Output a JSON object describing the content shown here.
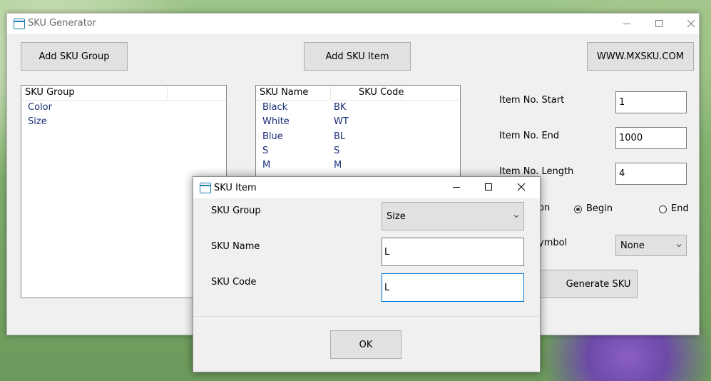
{
  "main_window": {
    "title": "SKU Generator",
    "add_group_button": "Add SKU Group",
    "add_item_button": "Add SKU Item",
    "website_button": "WWW.MXSKU.COM",
    "group_list": {
      "header": "SKU Group",
      "items": [
        "Color",
        "Size"
      ]
    },
    "item_list": {
      "headers": [
        "SKU Name",
        "SKU Code"
      ],
      "rows": [
        {
          "name": "Black",
          "code": "BK"
        },
        {
          "name": "White",
          "code": "WT"
        },
        {
          "name": "Blue",
          "code": "BL"
        },
        {
          "name": "S",
          "code": "S"
        },
        {
          "name": "M",
          "code": "M"
        }
      ]
    },
    "settings": {
      "item_start_label": "Item No. Start",
      "item_start_value": "1",
      "item_end_label": "Item No. End",
      "item_end_value": "1000",
      "item_length_label": "Item No. Length",
      "item_length_value": "4",
      "position_label_partial": "on",
      "position_options": [
        {
          "label": "Begin",
          "selected": true
        },
        {
          "label": "End",
          "selected": false
        }
      ],
      "symbol_label_partial": "ymbol",
      "symbol_value": "None",
      "generate_button": "Generate SKU"
    }
  },
  "dialog": {
    "title": "SKU Item",
    "group_label": "SKU Group",
    "group_value": "Size",
    "name_label": "SKU Name",
    "name_value": "L",
    "code_label": "SKU Code",
    "code_value": "L",
    "ok_button": "OK"
  },
  "icons": [
    "app-window-icon",
    "minimize-icon",
    "maximize-icon",
    "close-icon",
    "chevron-down-icon"
  ],
  "colors": {
    "accent": "#0078d7",
    "list_text": "#1a2f7a",
    "app_icon": "#1a7fa8",
    "window_bg": "#f0f0f0",
    "button_bg": "#e1e1e1"
  }
}
